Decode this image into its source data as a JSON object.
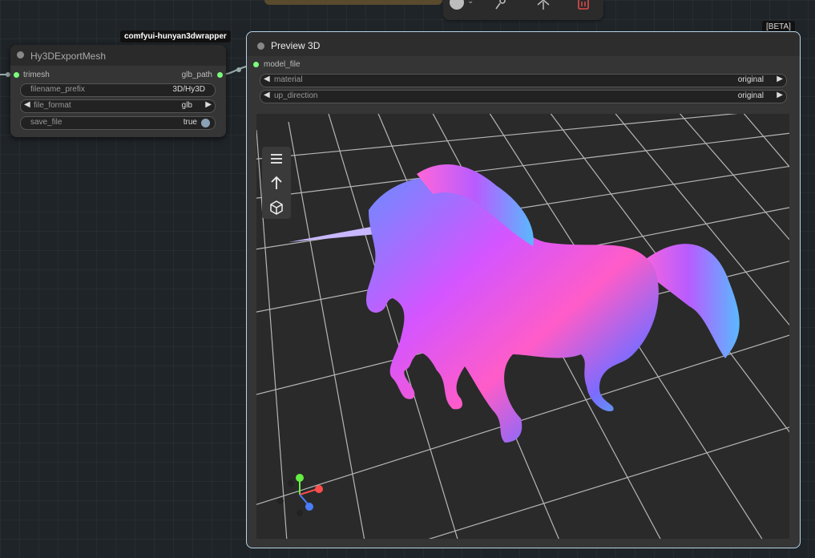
{
  "toolbar": {
    "color_icon": "color-circle",
    "icons": [
      "pin-icon",
      "bypass-icon",
      "delete-icon"
    ],
    "delete_color": "#e04a4a"
  },
  "export_node": {
    "badge": "comfyui-hunyan3dwrapper",
    "title": "Hy3DExportMesh",
    "input_label": "trimesh",
    "output_label": "glb_path",
    "widgets": {
      "filename_prefix": {
        "name": "filename_prefix",
        "value": "3D/Hy3D"
      },
      "file_format": {
        "name": "file_format",
        "value": "glb"
      },
      "save_file": {
        "name": "save_file",
        "value": "true"
      }
    }
  },
  "preview_node": {
    "badge": "[BETA]",
    "title": "Preview 3D",
    "input_label": "model_file",
    "widgets": {
      "material": {
        "name": "material",
        "value": "original"
      },
      "up_direction": {
        "name": "up_direction",
        "value": "original"
      }
    },
    "viewport_buttons": [
      "menu-icon",
      "up-arrow-icon",
      "cube-icon"
    ],
    "gizmo_colors": {
      "x": "#ff4d4d",
      "y": "#66ee44",
      "z": "#4a7dff"
    }
  },
  "colors": {
    "slot_green": "#7cfc7c",
    "selected_border": "#b6d4e8"
  }
}
